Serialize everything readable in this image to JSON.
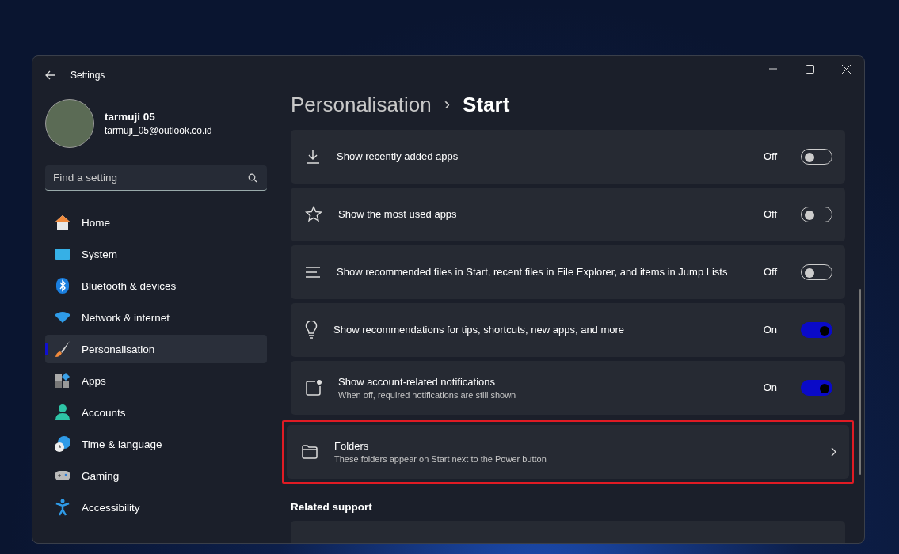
{
  "window": {
    "title": "Settings"
  },
  "account": {
    "name": "tarmuji 05",
    "email": "tarmuji_05@outlook.co.id"
  },
  "search": {
    "placeholder": "Find a setting"
  },
  "sidebar": {
    "items": [
      {
        "label": "Home",
        "selected": false
      },
      {
        "label": "System",
        "selected": false
      },
      {
        "label": "Bluetooth & devices",
        "selected": false
      },
      {
        "label": "Network & internet",
        "selected": false
      },
      {
        "label": "Personalisation",
        "selected": true
      },
      {
        "label": "Apps",
        "selected": false
      },
      {
        "label": "Accounts",
        "selected": false
      },
      {
        "label": "Time & language",
        "selected": false
      },
      {
        "label": "Gaming",
        "selected": false
      },
      {
        "label": "Accessibility",
        "selected": false
      }
    ]
  },
  "breadcrumb": {
    "parent": "Personalisation",
    "separator": "›",
    "current": "Start"
  },
  "settings": [
    {
      "kind": "toggle",
      "title": "Show recently added apps",
      "on": false,
      "state_label": "Off"
    },
    {
      "kind": "toggle",
      "title": "Show the most used apps",
      "on": false,
      "state_label": "Off"
    },
    {
      "kind": "toggle",
      "title": "Show recommended files in Start, recent files in File Explorer, and items in Jump Lists",
      "on": false,
      "state_label": "Off"
    },
    {
      "kind": "toggle",
      "title": "Show recommendations for tips, shortcuts, new apps, and more",
      "on": true,
      "state_label": "On"
    },
    {
      "kind": "toggle",
      "title": "Show account-related notifications",
      "description": "When off, required notifications are still shown",
      "on": true,
      "state_label": "On"
    },
    {
      "kind": "link",
      "title": "Folders",
      "description": "These folders appear on Start next to the Power button",
      "highlighted": true
    }
  ],
  "related_support": {
    "heading": "Related support"
  }
}
